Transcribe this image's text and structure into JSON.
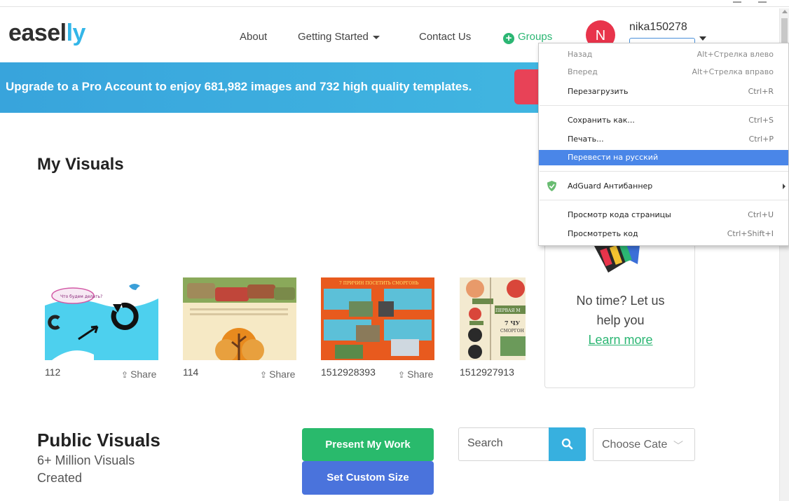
{
  "header": {
    "logo_main": "easel",
    "logo_accent": "ly",
    "nav": {
      "about": "About",
      "getting_started": "Getting Started",
      "contact": "Contact Us",
      "groups": "Groups"
    },
    "user": {
      "avatar_initial": "N",
      "username": "nika150278"
    }
  },
  "banner": {
    "text": "Upgrade to a Pro Account to enjoy 681,982 images and 732 high quality templates."
  },
  "my_visuals": {
    "title": "My Visuals",
    "share_label": "Share",
    "items": [
      {
        "name": "112"
      },
      {
        "name": "114"
      },
      {
        "name": "1512928393"
      },
      {
        "name": "1512927913"
      }
    ],
    "thumb_texts": {
      "cloud": "Что будем делать?",
      "poster_heading": "7 ПРИЧИН ПОСЕТИТЬ СМОРГОНЬ",
      "chart_heading": "ПЕРВАЯ М",
      "chart_sub1": "7 ЧУ",
      "chart_sub2": "СМОРГОН"
    }
  },
  "help_card": {
    "line1": "No time? Let us",
    "line2": "help you",
    "link": "Learn more"
  },
  "public_visuals": {
    "title": "Public Visuals",
    "sub_line1": "6+ Million Visuals",
    "sub_line2": "Created"
  },
  "buttons": {
    "present": "Present My Work",
    "custom_size": "Set Custom Size"
  },
  "search": {
    "placeholder": "Search",
    "category": "Choose Cate"
  },
  "context_menu": {
    "items": [
      {
        "label": "Назад",
        "shortcut": "Alt+Стрелка влево",
        "disabled": true
      },
      {
        "label": "Вперед",
        "shortcut": "Alt+Стрелка вправо",
        "disabled": true
      },
      {
        "label": "Перезагрузить",
        "shortcut": "Ctrl+R"
      },
      {
        "label": "Сохранить как...",
        "shortcut": "Ctrl+S"
      },
      {
        "label": "Печать...",
        "shortcut": "Ctrl+P"
      },
      {
        "label": "Перевести на русский",
        "shortcut": ""
      },
      {
        "label": "AdGuard Антибаннер",
        "shortcut": ""
      },
      {
        "label": "Просмотр кода страницы",
        "shortcut": "Ctrl+U"
      },
      {
        "label": "Просмотреть код",
        "shortcut": "Ctrl+Shift+I"
      }
    ]
  },
  "colors": {
    "brand_blue": "#33b6e8",
    "green": "#2bb673",
    "red": "#e8344b",
    "menu_highlight": "#4a86e8"
  }
}
